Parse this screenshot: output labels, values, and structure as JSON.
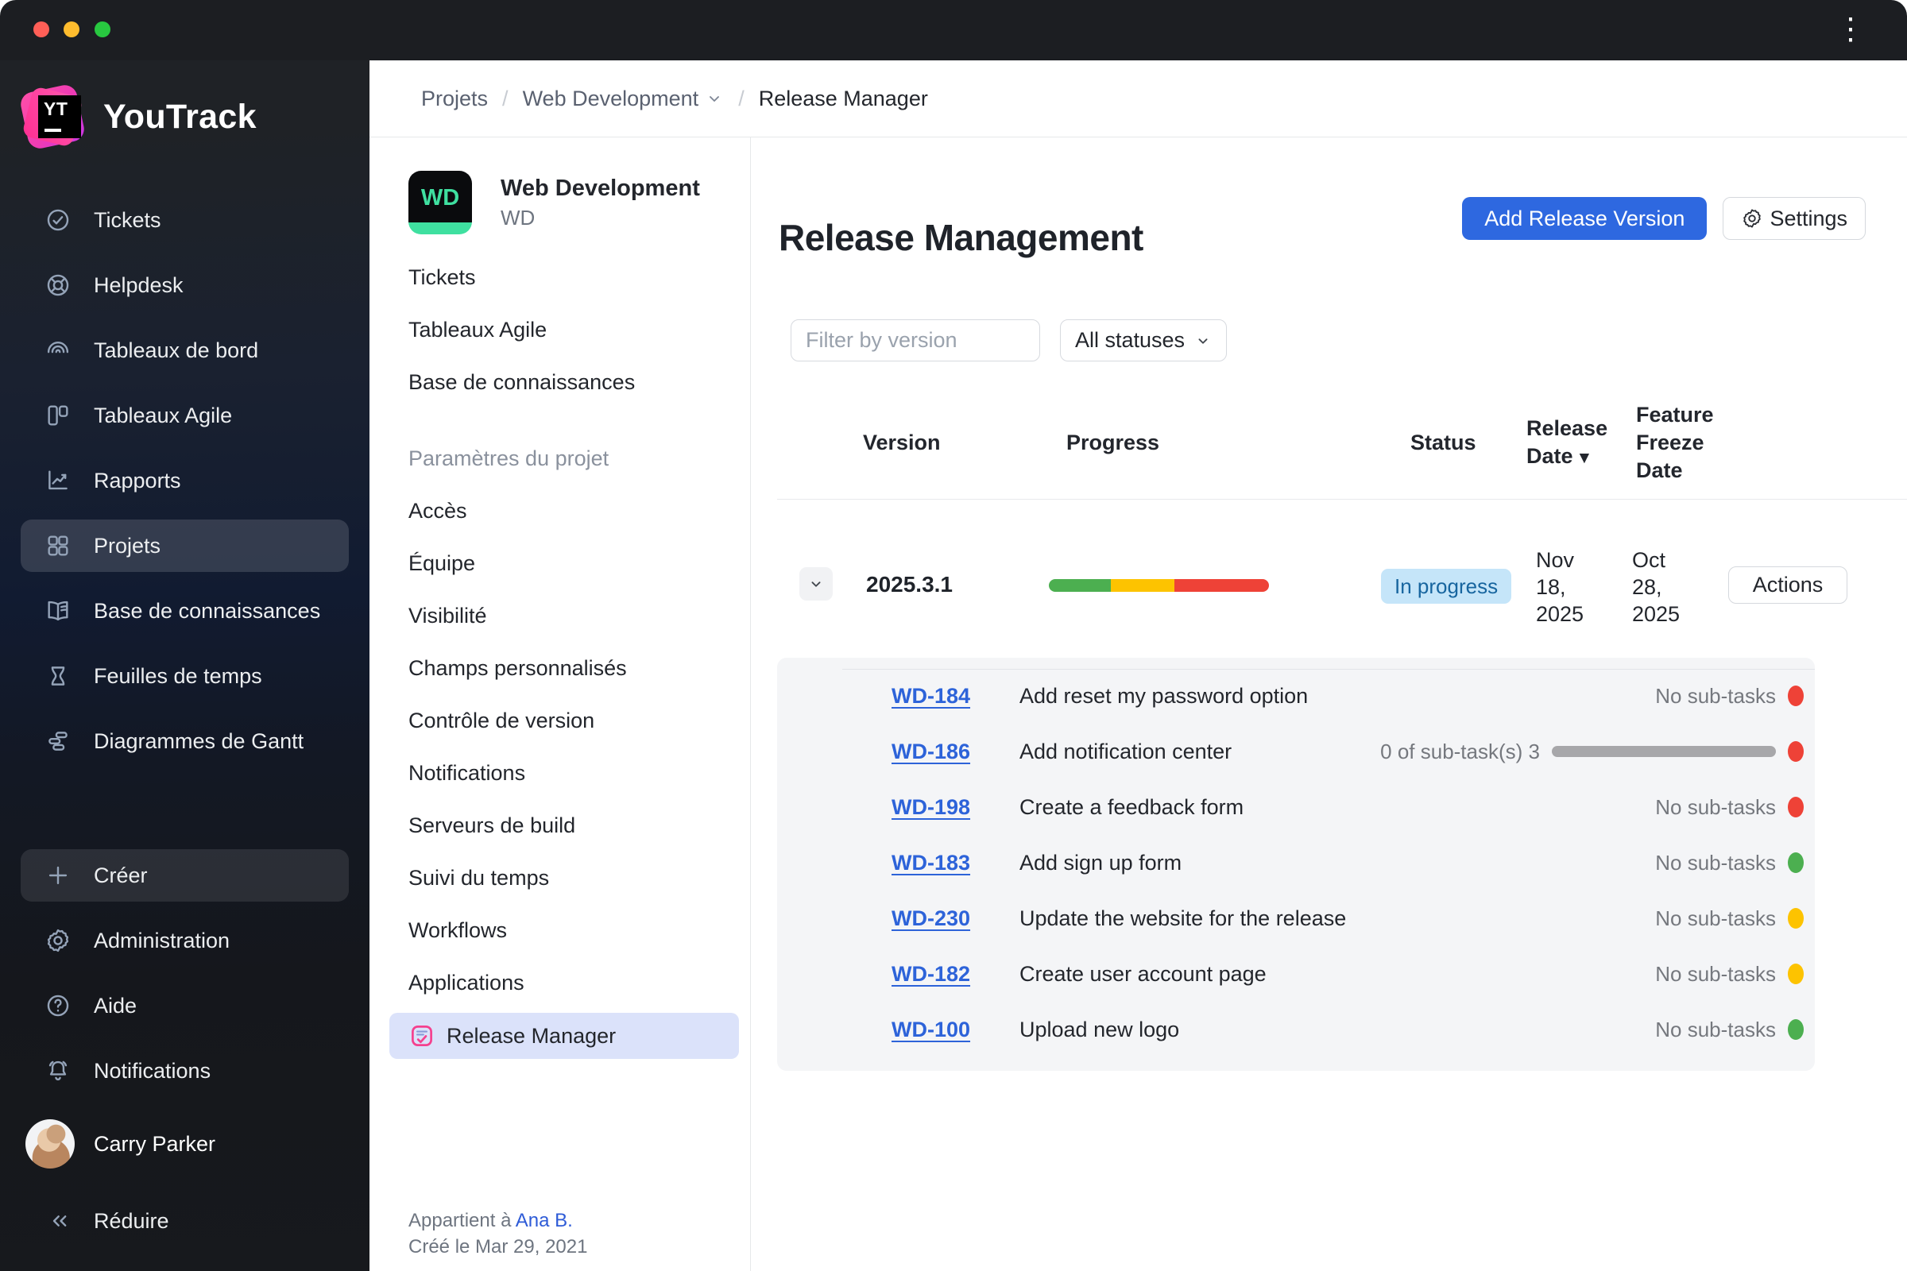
{
  "topbar": {
    "kebab_icon": "⋮"
  },
  "brand": {
    "name": "YouTrack",
    "badge": "YT"
  },
  "nav": {
    "items": [
      {
        "label": "Tickets",
        "icon": "check-circle-icon",
        "selected": false
      },
      {
        "label": "Helpdesk",
        "icon": "lifebuoy-icon",
        "selected": false
      },
      {
        "label": "Tableaux de bord",
        "icon": "gauge-icon",
        "selected": false
      },
      {
        "label": "Tableaux Agile",
        "icon": "board-icon",
        "selected": false
      },
      {
        "label": "Rapports",
        "icon": "chart-icon",
        "selected": false
      },
      {
        "label": "Projets",
        "icon": "grid-icon",
        "selected": true
      },
      {
        "label": "Base de connaissances",
        "icon": "book-icon",
        "selected": false
      },
      {
        "label": "Feuilles de temps",
        "icon": "hourglass-icon",
        "selected": false
      },
      {
        "label": "Diagrammes de Gantt",
        "icon": "gantt-icon",
        "selected": false
      }
    ],
    "actions": [
      {
        "label": "Créer",
        "icon": "plus-icon"
      },
      {
        "label": "Administration",
        "icon": "gear-icon"
      },
      {
        "label": "Aide",
        "icon": "help-icon"
      },
      {
        "label": "Notifications",
        "icon": "bell-icon"
      }
    ],
    "user": {
      "name": "Carry Parker"
    },
    "collapse_label": "Réduire"
  },
  "breadcrumb": {
    "item1": "Projets",
    "item2": "Web Development",
    "item3": "Release Manager"
  },
  "project": {
    "avatar_text": "WD",
    "name": "Web Development",
    "key": "WD",
    "links": [
      "Tickets",
      "Tableaux Agile",
      "Base de connaissances"
    ],
    "settings_heading": "Paramètres du projet",
    "settings": [
      "Accès",
      "Équipe",
      "Visibilité",
      "Champs personnalisés",
      "Contrôle de version",
      "Notifications",
      "Serveurs de build",
      "Suivi du temps",
      "Workflows",
      "Applications"
    ],
    "app_link": "Release Manager",
    "owner_prefix": "Appartient à",
    "owner_name": "Ana B.",
    "created": "Créé le Mar 29, 2021"
  },
  "main": {
    "title": "Release Management",
    "add_button": "Add Release Version",
    "settings_button": "Settings",
    "filter_placeholder": "Filter by version",
    "status_filter": "All statuses",
    "sort_icon": "▼",
    "columns": [
      "Version",
      "Progress",
      "Status",
      "Release Date",
      "Feature Freeze Date"
    ],
    "release": {
      "version": "2025.3.1",
      "progress": [
        {
          "color": "#4caf50",
          "width": "28%"
        },
        {
          "color": "#fdc300",
          "width": "29%"
        },
        {
          "color": "#ee4237",
          "width": "43%"
        }
      ],
      "status": "In progress",
      "release_date": "Nov 18, 2025",
      "freeze_date": "Oct 28, 2025",
      "actions_button": "Actions"
    },
    "issues": [
      {
        "id": "WD-184",
        "title": "Add reset my password option",
        "subtasks": "No sub-tasks",
        "dot": "red"
      },
      {
        "id": "WD-186",
        "title": "Add notification center",
        "subtasks": "0 of sub-task(s) 3",
        "dot": "red"
      },
      {
        "id": "WD-198",
        "title": "Create a feedback form",
        "subtasks": "No sub-tasks",
        "dot": "red"
      },
      {
        "id": "WD-183",
        "title": "Add sign up form",
        "subtasks": "No sub-tasks",
        "dot": "green"
      },
      {
        "id": "WD-230",
        "title": "Update the website for the release",
        "subtasks": "No sub-tasks",
        "dot": "yellow"
      },
      {
        "id": "WD-182",
        "title": "Create user account page",
        "subtasks": "No sub-tasks",
        "dot": "yellow"
      },
      {
        "id": "WD-100",
        "title": "Upload new logo",
        "subtasks": "No sub-tasks",
        "dot": "green"
      }
    ]
  },
  "colors": {
    "accent_blue": "#2e68e0",
    "status_badge_bg": "#c5e5f9",
    "status_badge_text": "#17659f",
    "green": "#4caf50",
    "yellow": "#fdc300",
    "red": "#ee4237",
    "selected_item_bg": "#dbe2fa",
    "project_accent": "#3fe0a0"
  }
}
